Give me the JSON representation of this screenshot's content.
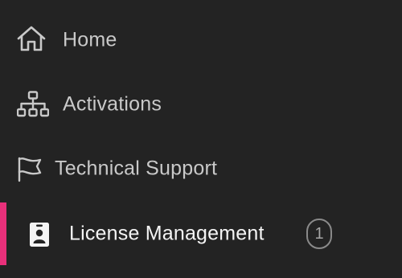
{
  "sidebar": {
    "items": [
      {
        "label": "Home",
        "icon": "home-icon",
        "active": false
      },
      {
        "label": "Activations",
        "icon": "sitemap-icon",
        "active": false
      },
      {
        "label": "Technical Support",
        "icon": "flag-icon",
        "active": false
      },
      {
        "label": "License Management",
        "icon": "id-badge-icon",
        "active": true,
        "badge": "1"
      }
    ]
  },
  "colors": {
    "background": "#232323",
    "active_indicator": "#e8307a",
    "text": "#c9c9c9",
    "active_text": "#f4f4f4"
  }
}
